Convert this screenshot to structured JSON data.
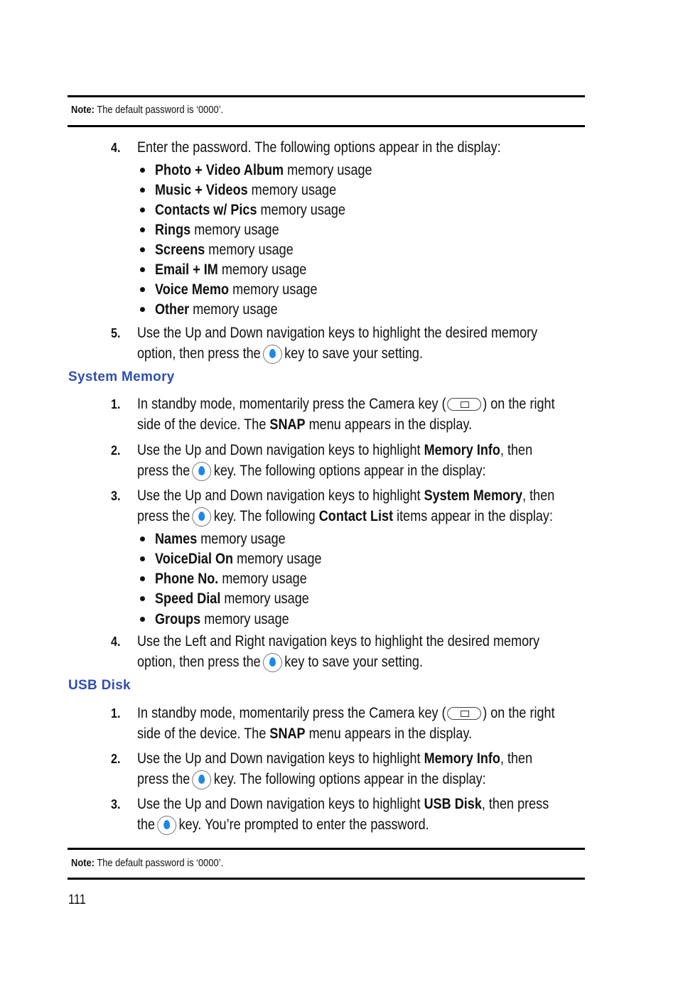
{
  "note_top": {
    "label": "Note:",
    "text": " The default password is ‘0000’."
  },
  "section1": {
    "step4": {
      "num": "4.",
      "text": "Enter the password. The following options appear in the display:"
    },
    "bullets": [
      {
        "bold": "Photo + Video Album",
        "rest": " memory usage"
      },
      {
        "bold": "Music + Videos",
        "rest": " memory usage"
      },
      {
        "bold": "Contacts w/ Pics",
        "rest": " memory usage"
      },
      {
        "bold": "Rings",
        "rest": " memory usage"
      },
      {
        "bold": "Screens",
        "rest": " memory usage"
      },
      {
        "bold": "Email + IM",
        "rest": " memory usage"
      },
      {
        "bold": "Voice Memo",
        "rest": " memory usage"
      },
      {
        "bold": "Other",
        "rest": " memory usage"
      }
    ],
    "step5": {
      "num": "5.",
      "line1": "Use the Up and Down navigation keys to highlight the desired memory",
      "line2a": "option, then press the",
      "line2b": "key to save your setting."
    }
  },
  "system_memory": {
    "heading": "System Memory",
    "step1": {
      "num": "1.",
      "line1a": "In standby mode, momentarily press the Camera key (",
      "line1b": ") on the right",
      "line2a": "side of the device. The ",
      "line2bold": "SNAP",
      "line2b": " menu appears in the display."
    },
    "step2": {
      "num": "2.",
      "line1a": "Use the Up and Down navigation keys to highlight ",
      "line1bold": "Memory Info",
      "line1b": ", then",
      "line2a": "press the",
      "line2b": "key. The following options appear in the display:"
    },
    "step3": {
      "num": "3.",
      "line1a": "Use the Up and Down navigation keys to highlight ",
      "line1bold": "System Memory",
      "line1b": ", then",
      "line2a": "press the",
      "line2b": "key. The following ",
      "line2bold": "Contact List",
      "line2c": " items appear in the display:"
    },
    "bullets": [
      {
        "bold": "Names",
        "rest": " memory usage"
      },
      {
        "bold": "VoiceDial On",
        "rest": " memory usage"
      },
      {
        "bold": "Phone No.",
        "rest": " memory usage"
      },
      {
        "bold": "Speed Dial",
        "rest": " memory usage"
      },
      {
        "bold": "Groups",
        "rest": " memory usage"
      }
    ],
    "step4": {
      "num": "4.",
      "line1": "Use the Left and Right navigation keys to highlight the desired memory",
      "line2a": "option, then press the",
      "line2b": "key to save your setting."
    }
  },
  "usb_disk": {
    "heading": "USB Disk",
    "step1": {
      "num": "1.",
      "line1a": "In standby mode, momentarily press the Camera key (",
      "line1b": ") on the right",
      "line2a": "side of the device. The ",
      "line2bold": "SNAP",
      "line2b": " menu appears in the display."
    },
    "step2": {
      "num": "2.",
      "line1a": "Use the Up and Down navigation keys to highlight ",
      "line1bold": "Memory Info",
      "line1b": ", then",
      "line2a": "press the",
      "line2b": "key. The following options appear in the display:"
    },
    "step3": {
      "num": "3.",
      "line1a": "Use the Up and Down navigation keys to highlight ",
      "line1bold": "USB Disk",
      "line1b": ", then press",
      "line2a": "the",
      "line2b": "key. You’re prompted to enter the password."
    }
  },
  "note_bottom": {
    "label": "Note:",
    "text": " The default password is ‘0000’."
  },
  "page_number": "111",
  "colors": {
    "heading": "#2f4fb0",
    "ok_key": "#1e88e5"
  }
}
